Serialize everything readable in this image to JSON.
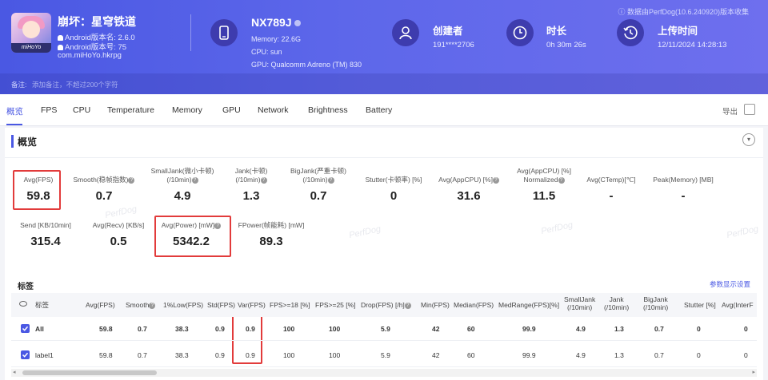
{
  "header": {
    "app_icon_text": "miHoYo",
    "app_name": "崩坏：星穹铁道",
    "android_version": "Android版本名: 2.6.0",
    "android_code": "Android版本号: 75",
    "package": "com.miHoYo.hkrpg",
    "device_name": "NX789J",
    "memory": "Memory: 22.6G",
    "cpu": "CPU: sun",
    "gpu": "GPU: Qualcomm Adreno (TM) 830",
    "creator_label": "创建者",
    "creator_value": "191****2706",
    "duration_label": "时长",
    "duration_value": "0h 30m 26s",
    "upload_label": "上传时间",
    "upload_value": "12/11/2024 14:28:13",
    "version_note": "ⓘ 数据由PerfDog(10.6.240920)版本收集",
    "note_label": "备注:",
    "note_placeholder": "添加备注，不超过200个字符"
  },
  "tabs": [
    "概览",
    "FPS",
    "CPU",
    "Temperature",
    "Memory",
    "GPU",
    "Network",
    "Brightness",
    "Battery"
  ],
  "export_label": "导出",
  "section_title": "概览",
  "metrics_row1": [
    {
      "label": "Avg(FPS)",
      "value": "59.8"
    },
    {
      "label": "Smooth(稳帧指数)",
      "value": "0.7"
    },
    {
      "label": "SmallJank(微小卡顿)\n(/10min)",
      "value": "4.9"
    },
    {
      "label": "Jank(卡顿)\n(/10min)",
      "value": "1.3"
    },
    {
      "label": "BigJank(严重卡顿)\n(/10min)",
      "value": "0.7"
    },
    {
      "label": "Stutter(卡顿率) [%]",
      "value": "0"
    },
    {
      "label": "Avg(AppCPU) [%]",
      "value": "31.6"
    },
    {
      "label": "Avg(AppCPU) [%]\nNormalized",
      "value": "11.5"
    },
    {
      "label": "Avg(CTemp)[℃]",
      "value": "-"
    },
    {
      "label": "Peak(Memory) [MB]",
      "value": "-"
    }
  ],
  "metrics_row2": [
    {
      "label": "Send [KB/10min]",
      "value": "315.4"
    },
    {
      "label": "Avg(Recv) [KB/s]",
      "value": "0.5"
    },
    {
      "label": "Avg(Power) [mW]",
      "value": "5342.2"
    },
    {
      "label": "FPower(帧能耗) [mW]",
      "value": "89.3"
    }
  ],
  "watermark": "PerfDog",
  "tags_title": "标签",
  "tags_link": "参数显示设置",
  "table": {
    "columns": [
      "标签",
      "Avg(FPS)",
      "Smooth",
      "1%Low(FPS)",
      "Std(FPS)",
      "Var(FPS)",
      "FPS>=18 [%]",
      "FPS>=25 [%]",
      "Drop(FPS) [/h]",
      "Min(FPS)",
      "Median(FPS)",
      "MedRange(FPS)[%]",
      "SmallJank\n(/10min)",
      "Jank\n(/10min)",
      "BigJank\n(/10min)",
      "Stutter [%]",
      "Avg(InterF"
    ],
    "rows": [
      [
        "All",
        "59.8",
        "0.7",
        "38.3",
        "0.9",
        "0.9",
        "100",
        "100",
        "5.9",
        "42",
        "60",
        "99.9",
        "4.9",
        "1.3",
        "0.7",
        "0",
        "0"
      ],
      [
        "label1",
        "59.8",
        "0.7",
        "38.3",
        "0.9",
        "0.9",
        "100",
        "100",
        "5.9",
        "42",
        "60",
        "99.9",
        "4.9",
        "1.3",
        "0.7",
        "0",
        "0"
      ]
    ]
  }
}
